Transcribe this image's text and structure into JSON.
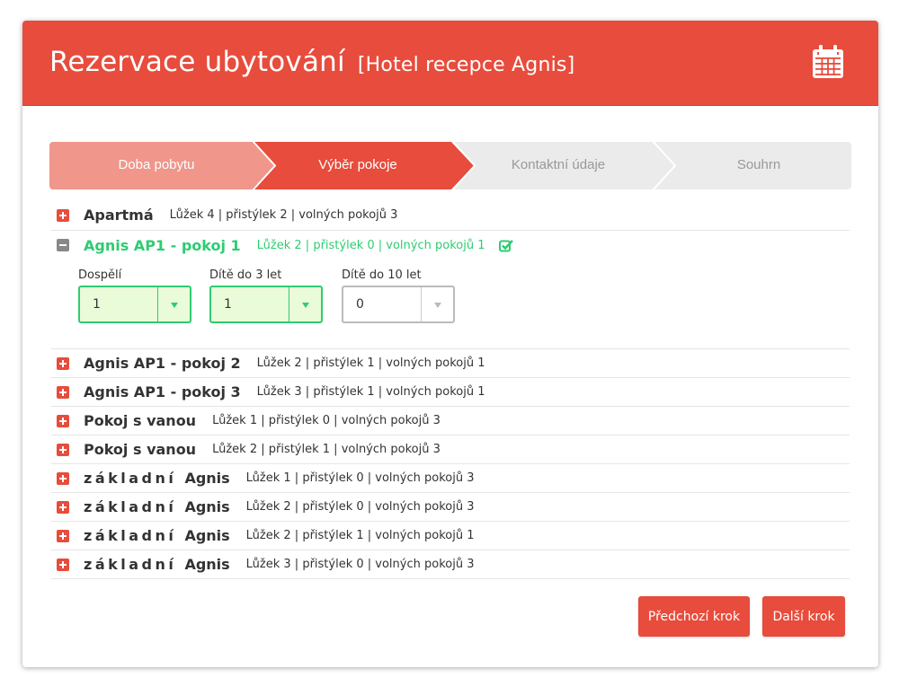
{
  "header": {
    "title": "Rezervace ubytování",
    "subtitle": "[Hotel recepce Agnis]",
    "icon": "calendar-icon"
  },
  "colors": {
    "accent": "#e74c3c",
    "accent_light": "#f0968b",
    "inactive_step": "#ebebeb",
    "success": "#2ecc71"
  },
  "steps": [
    {
      "label": "Doba pobytu",
      "state": "done"
    },
    {
      "label": "Výběr pokoje",
      "state": "active"
    },
    {
      "label": "Kontaktní údaje",
      "state": "pending"
    },
    {
      "label": "Souhrn",
      "state": "pending"
    }
  ],
  "rooms": [
    {
      "name": "Apartmá",
      "info": "Lůžek 4 | přistýlek 2 | volných pokojů 3"
    },
    {
      "name": "Agnis AP1 - pokoj 1",
      "info": "Lůžek 2 | přistýlek 0 | volných pokojů 1",
      "expanded": true
    },
    {
      "name": "Agnis AP1 - pokoj 2",
      "info": "Lůžek 2 | přistýlek 1 | volných pokojů 1"
    },
    {
      "name": "Agnis AP1 - pokoj 3",
      "info": "Lůžek 3 | přistýlek 1 | volných pokojů 1"
    },
    {
      "name": "Pokoj s vanou",
      "info": "Lůžek 1 | přistýlek 0 | volných pokojů 3"
    },
    {
      "name": "Pokoj s vanou",
      "info": "Lůžek 2 | přistýlek 1 | volných pokojů 3"
    },
    {
      "name_spaced": "základní",
      "name_rest": "Agnis",
      "info": "Lůžek 1 | přistýlek 0 | volných pokojů 3"
    },
    {
      "name_spaced": "základní",
      "name_rest": "Agnis",
      "info": "Lůžek 2 | přistýlek 0 | volných pokojů 3"
    },
    {
      "name_spaced": "základní",
      "name_rest": "Agnis",
      "info": "Lůžek 2 | přistýlek 1 | volných pokojů 1"
    },
    {
      "name_spaced": "základní",
      "name_rest": "Agnis",
      "info": "Lůžek 3 | přistýlek 0 | volných pokojů 3"
    }
  ],
  "occupancy": {
    "adults": {
      "label": "Dospělí",
      "value": "1"
    },
    "children3": {
      "label": "Dítě do 3 let",
      "value": "1"
    },
    "children10": {
      "label": "Dítě do 10 let",
      "value": "0"
    }
  },
  "buttons": {
    "prev": "Předchozí krok",
    "next": "Další krok"
  }
}
